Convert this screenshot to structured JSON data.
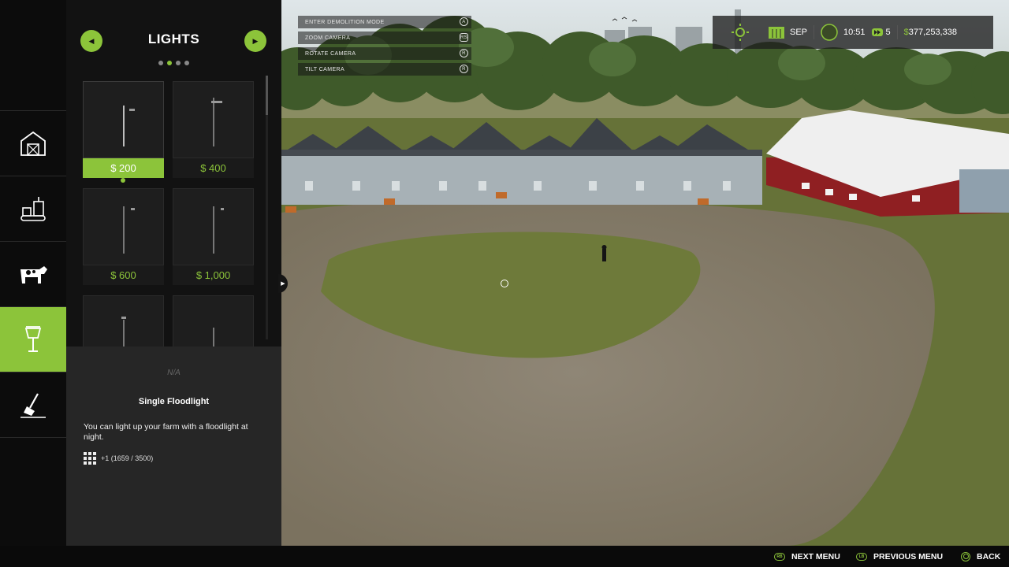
{
  "store": {
    "category_title": "LIGHTS",
    "pages": 4,
    "active_page": 2,
    "items": [
      {
        "price": "$ 200",
        "selected": true
      },
      {
        "price": "$ 400",
        "selected": false
      },
      {
        "price": "$ 600",
        "selected": false
      },
      {
        "price": "$ 1,000",
        "selected": false
      },
      {
        "price": "",
        "selected": false
      },
      {
        "price": "",
        "selected": false
      }
    ]
  },
  "categories": [
    {
      "icon": "barn-icon"
    },
    {
      "icon": "factory-icon"
    },
    {
      "icon": "cow-icon"
    },
    {
      "icon": "street-lamp-icon",
      "active": true
    },
    {
      "icon": "shovel-icon"
    }
  ],
  "info": {
    "na": "N/A",
    "name": "Single Floodlight",
    "description": "You can light up your farm with a floodlight at night.",
    "slots": "+1 (1659 / 3500)"
  },
  "hints": [
    {
      "label": "ENTER DEMOLITION MODE",
      "key": "A"
    },
    {
      "label": "ZOOM CAMERA",
      "key": "RS"
    },
    {
      "label": "ROTATE CAMERA",
      "key": "R"
    },
    {
      "label": "TILT CAMERA",
      "key": "R"
    }
  ],
  "hud": {
    "month": "SEP",
    "time": "10:51",
    "speed": "5",
    "money": "377,253,338",
    "money_prefix": "$"
  },
  "bottom": {
    "next_menu": "NEXT MENU",
    "previous_menu": "PREVIOUS MENU",
    "back": "BACK",
    "next_key": "RB",
    "prev_key": "LB"
  },
  "colors": {
    "accent": "#8cc43a",
    "panel": "#121212",
    "info_panel": "#262626"
  }
}
